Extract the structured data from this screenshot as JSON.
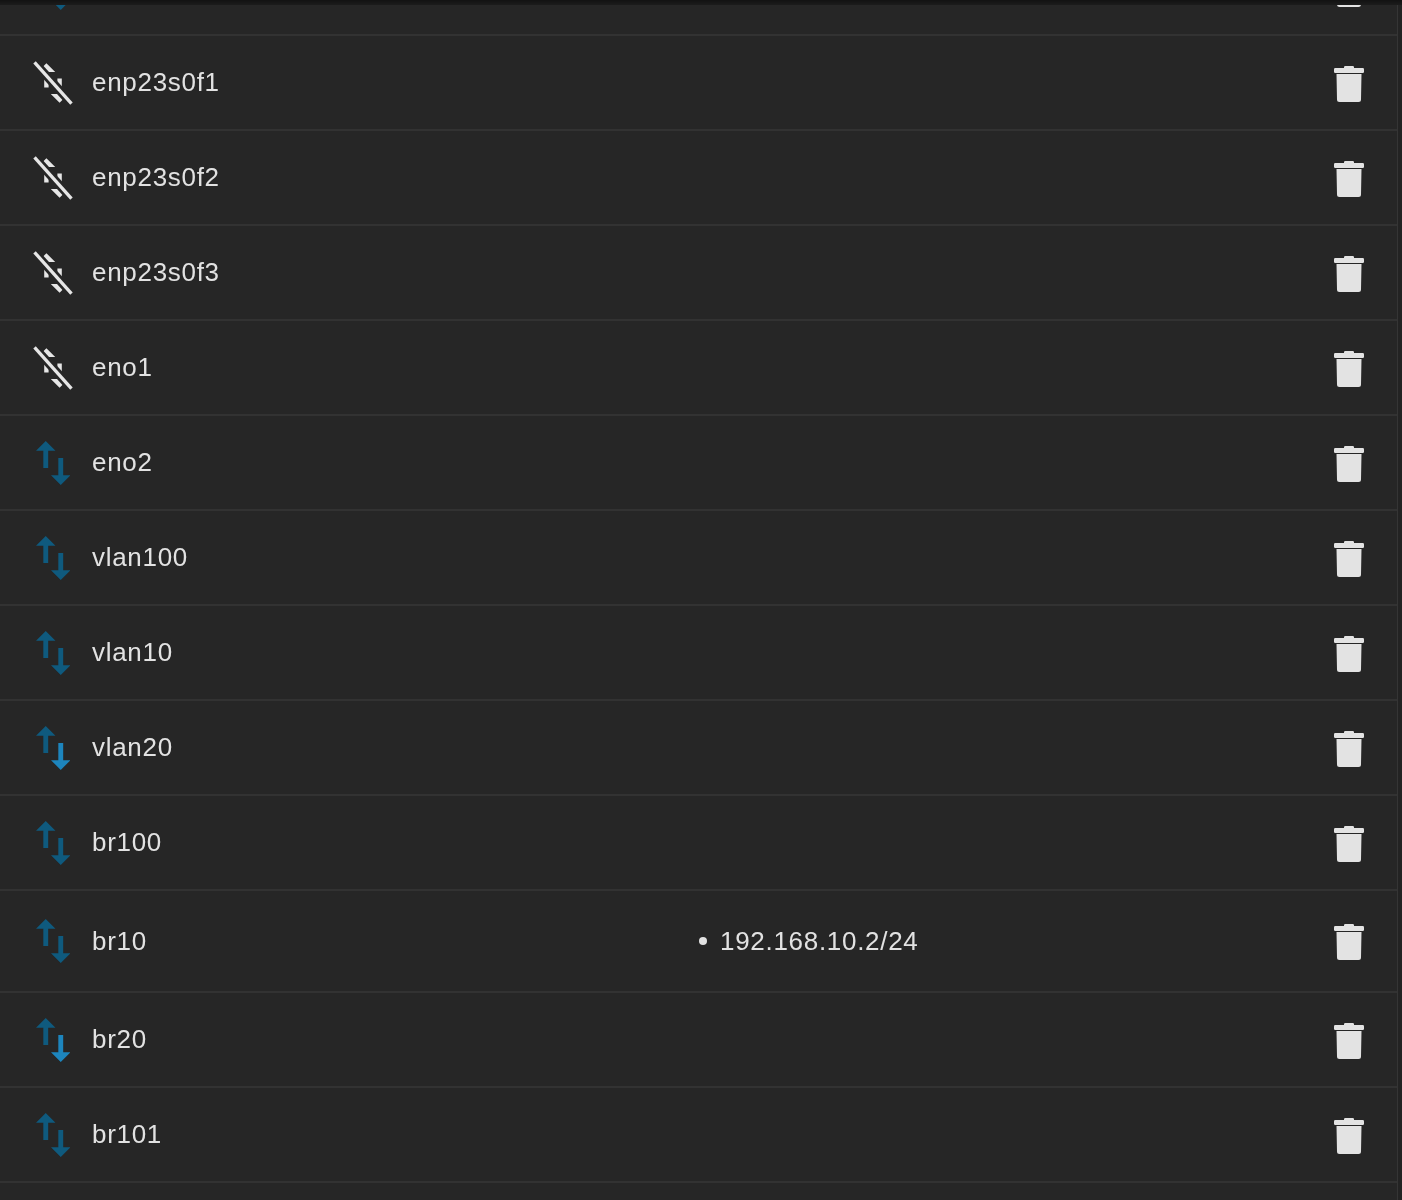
{
  "interfaces": [
    {
      "connected": true,
      "rx_active": false
    },
    {
      "name": "enp23s0f1",
      "connected": false
    },
    {
      "name": "enp23s0f2",
      "connected": false
    },
    {
      "name": "enp23s0f3",
      "connected": false
    },
    {
      "name": "eno1",
      "connected": false
    },
    {
      "name": "eno2",
      "connected": true,
      "tx_active": false,
      "rx_active": false
    },
    {
      "name": "vlan100",
      "connected": true,
      "tx_active": false,
      "rx_active": false
    },
    {
      "name": "vlan10",
      "connected": true,
      "tx_active": false,
      "rx_active": false
    },
    {
      "name": "vlan20",
      "connected": true,
      "tx_active": false,
      "rx_active": true
    },
    {
      "name": "br100",
      "connected": true,
      "tx_active": false,
      "rx_active": false
    },
    {
      "name": "br10",
      "connected": true,
      "tx_active": false,
      "rx_active": false,
      "addresses": [
        "192.168.10.2/24"
      ]
    },
    {
      "name": "br20",
      "connected": true,
      "tx_active": false,
      "rx_active": true
    },
    {
      "name": "br101",
      "connected": true,
      "tx_active": false,
      "rx_active": false
    }
  ]
}
